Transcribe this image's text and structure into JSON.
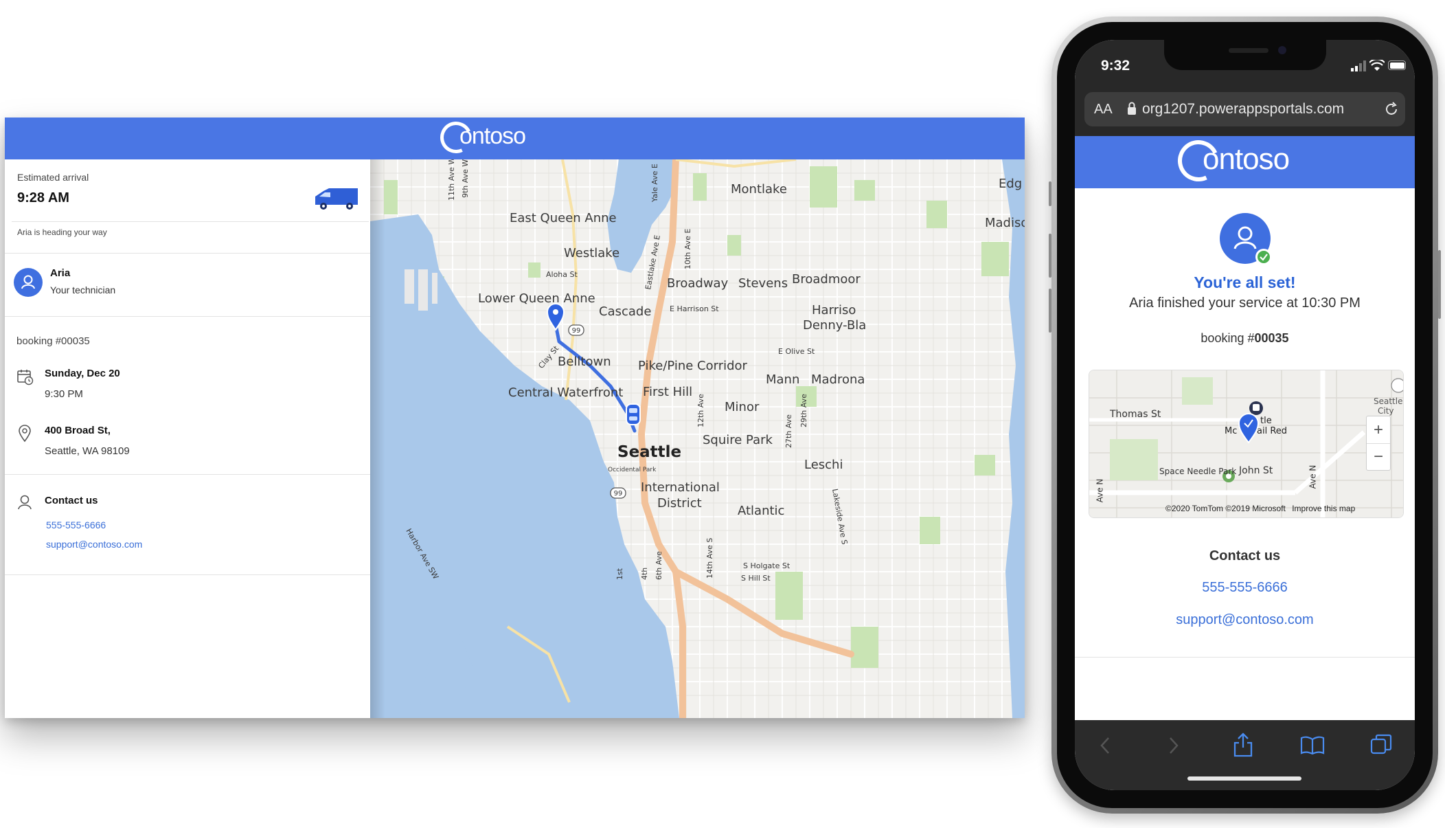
{
  "desktop": {
    "eta": {
      "label": "Estimated arrival",
      "time": "9:28 AM",
      "status": "Aria is heading your way",
      "icon": "van-icon"
    },
    "technician": {
      "name": "Aria",
      "role": "Your technician",
      "icon": "person-icon"
    },
    "booking": {
      "label": "booking #00035",
      "date": "Sunday, Dec 20",
      "time": "9:30 PM",
      "address_line1": "400 Broad St,",
      "address_line2": "Seattle, WA 98109"
    },
    "contact": {
      "title": "Contact us",
      "phone": "555-555-6666",
      "email": "support@contoso.com"
    },
    "logo_text": "ontoso",
    "map_labels": {
      "east_queen_anne": "East Queen Anne",
      "westlake": "Westlake",
      "montlake": "Montlake",
      "edg": "Edg",
      "madison": "Madiso",
      "aloha": "Aloha St",
      "broadway": "Broadway",
      "stevens": "Stevens",
      "broadmoor": "Broadmoor",
      "lower_queen_anne": "Lower Queen Anne",
      "cascade": "Cascade",
      "harrison_st": "E Harrison St",
      "harrison_denny_1": "Harriso",
      "harrison_denny_2": "Denny-Bla",
      "clay": "Clay St",
      "olive": "E Olive St",
      "belltown": "Belltown",
      "pike_pine": "Pike/Pine Corridor",
      "mann": "Mann",
      "madrona": "Madrona",
      "central_waterfront": "Central Waterfront",
      "first_hill": "First Hill",
      "minor": "Minor",
      "squire_park": "Squire Park",
      "seattle": "Seattle",
      "leschi": "Leschi",
      "occidental": "Occidental Park",
      "international_1": "International",
      "international_2": "District",
      "atlantic": "Atlantic",
      "holgate": "S Holgate St",
      "hill": "S Hill St",
      "ave_11": "11th Ave W",
      "ave_9": "9th Ave W",
      "yale": "Yale Ave E",
      "eastlake": "Eastlake Ave E",
      "ave_10": "10th Ave E",
      "ave_12": "12th Ave",
      "ave_27": "27th Ave",
      "ave_29": "29th Ave",
      "lakeside": "Lakeside Ave S",
      "harbor": "Harbor Ave SW",
      "ave_14": "14th Ave S",
      "first": "1st",
      "fourth": "4th",
      "sixth": "6th Ave",
      "hwy99": "99"
    }
  },
  "phone": {
    "status_time": "9:32",
    "aa_label": "AA",
    "url": "org1207.powerappsportals.com",
    "logo_text": "ontoso",
    "title": "You're all set!",
    "message": "Aria finished your service at 10:30 PM",
    "booking_prefix": "booking #",
    "booking_number": "00035",
    "map": {
      "thomas": "Thomas St",
      "seattle_city_1": "Seattle",
      "seattle_city_2": "City",
      "tle": "tle",
      "mcaw": "Mc",
      "ail_red": "ail Red",
      "space_needle": "Space Needle Park",
      "john": "John St",
      "ave_n_left": "Ave N",
      "ave_n_right": "Ave N",
      "zoom_in": "+",
      "zoom_out": "−",
      "copyright": "©2020 TomTom ©2019 Microsoft",
      "improve": "Improve this map"
    },
    "contact_title": "Contact us",
    "phone": "555-555-6666",
    "email": "support@contoso.com"
  },
  "colors": {
    "brand_blue": "#4a76e4",
    "link_blue": "#3a6fd8",
    "water": "#a9c8ea",
    "land": "#f2f1ee",
    "park": "#c9e4b4",
    "route": "#3f6fe0",
    "highway": "#f2c29a",
    "success_green": "#4caf50"
  }
}
